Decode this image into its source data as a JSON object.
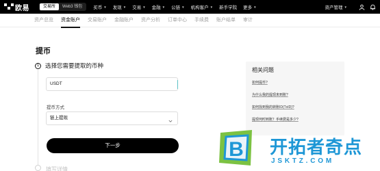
{
  "header": {
    "logo_text": "欧易",
    "mode_tabs": [
      "交易所",
      "Web3 钱包"
    ],
    "nav_items": [
      "买币",
      "发现",
      "交易",
      "金融",
      "公链",
      "机构客户",
      "新手学院",
      "更多"
    ],
    "asset_mgmt": "资产管理"
  },
  "subnav": {
    "tabs": [
      "资产总览",
      "资金账户",
      "交易账户",
      "金融账户",
      "资产分析",
      "订单中心",
      "手续费",
      "账户结单",
      "审计"
    ],
    "active_index": 1
  },
  "page": {
    "title": "提币"
  },
  "step1": {
    "number": "1",
    "label": "选择您需要提取的币种",
    "coin_value": "USDT",
    "method_label": "提币方式",
    "method_value": "链上提现",
    "next_label": "下一步"
  },
  "step2": {
    "label": "填写详情"
  },
  "faq": {
    "title": "相关问题",
    "links": [
      "如何提币?",
      "为什么我的提现未到账?",
      "如何找到我的转账ID(TxID)?",
      "提现何时到账？手续费是多少?"
    ]
  },
  "watermark": {
    "badge_letter": "B",
    "title": "开拓者奇点",
    "url": "JSKTZ.COM"
  },
  "colors": {
    "topbar": "#000000",
    "accent_button": "#000000",
    "watermark_blue": "#1e97d6",
    "watermark_green": "#7cc242"
  }
}
